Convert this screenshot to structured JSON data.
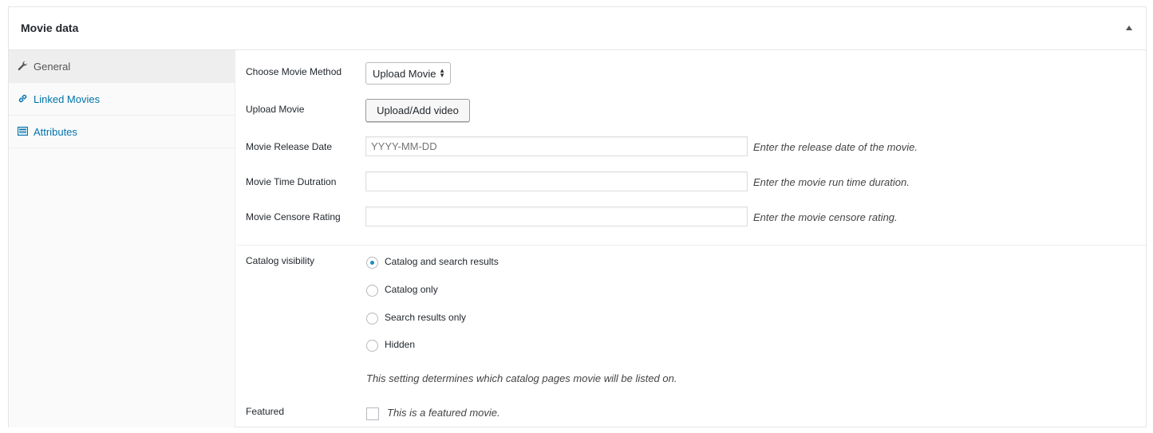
{
  "panel": {
    "title": "Movie data"
  },
  "sidebar": {
    "tabs": [
      {
        "label": "General",
        "icon": "wrench-icon",
        "active": true
      },
      {
        "label": "Linked Movies",
        "icon": "link-icon",
        "active": false
      },
      {
        "label": "Attributes",
        "icon": "list-icon",
        "active": false
      }
    ]
  },
  "general": {
    "method_label": "Choose Movie Method",
    "method_value": "Upload Movie",
    "upload_label": "Upload Movie",
    "upload_button": "Upload/Add video",
    "release_label": "Movie Release Date",
    "release_placeholder": "YYYY-MM-DD",
    "release_desc": "Enter the release date of the movie.",
    "duration_label": "Movie Time Dutration",
    "duration_value": "",
    "duration_desc": "Enter the movie run time duration.",
    "rating_label": "Movie Censore Rating",
    "rating_value": "",
    "rating_desc": "Enter the movie censore rating."
  },
  "visibility": {
    "label": "Catalog visibility",
    "options": [
      {
        "label": "Catalog and search results",
        "checked": true
      },
      {
        "label": "Catalog only",
        "checked": false
      },
      {
        "label": "Search results only",
        "checked": false
      },
      {
        "label": "Hidden",
        "checked": false
      }
    ],
    "note": "This setting determines which catalog pages movie will be listed on."
  },
  "featured": {
    "label": "Featured",
    "checkbox_label": "This is a featured movie.",
    "checked": false
  },
  "colors": {
    "link": "#0073aa",
    "radio_checked": "#1e8cbe"
  }
}
